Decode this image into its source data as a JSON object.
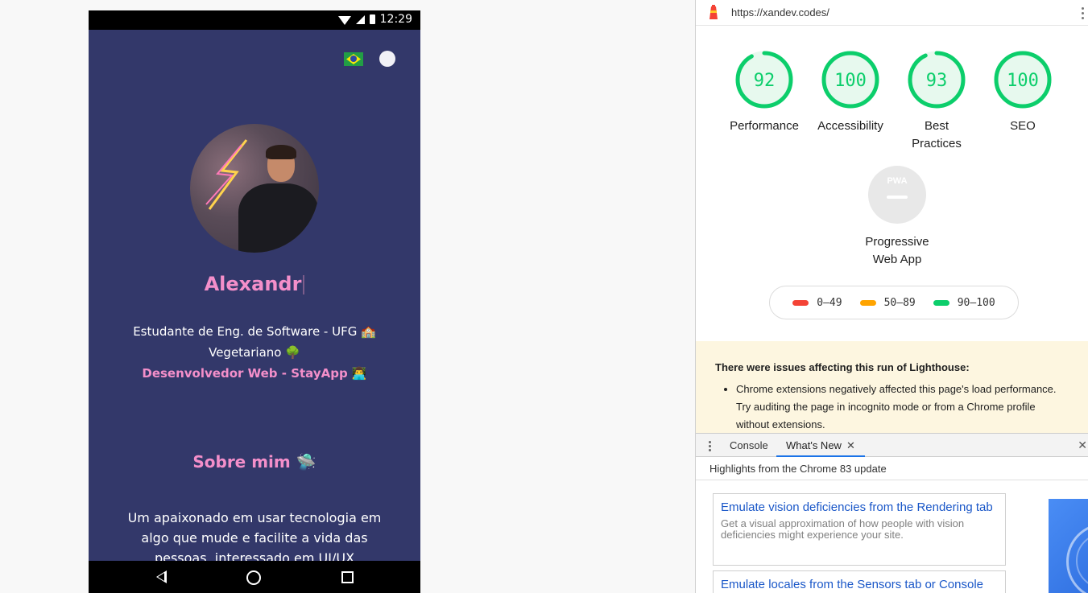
{
  "phone": {
    "status_time": "12:29",
    "name": "Alexandr",
    "bio_line1": "Estudante de Eng. de Software - UFG 🏫",
    "bio_line2": "Vegetariano 🌳",
    "bio_line3": "Desenvolvedor Web - StayApp 👨‍💻",
    "section_title": "Sobre mim 🛸",
    "about_text": "Um apaixonado em usar tecnologia em algo que mude e facilite a vida das pessoas, interessado em UI/UX"
  },
  "devtools": {
    "url": "https://xandev.codes/",
    "scores": [
      {
        "value": 92,
        "label": "Performance"
      },
      {
        "value": 100,
        "label": "Accessibility"
      },
      {
        "value": 93,
        "label": "Best Practices"
      },
      {
        "value": 100,
        "label": "SEO"
      }
    ],
    "pwa_badge": "PWA",
    "pwa_label": "Progressive Web App",
    "legend": [
      {
        "range": "0–49",
        "color": "#f44336"
      },
      {
        "range": "50–89",
        "color": "#ffa400"
      },
      {
        "range": "90–100",
        "color": "#0cce6b"
      }
    ],
    "warning_title": "There were issues affecting this run of Lighthouse:",
    "warning_item": "Chrome extensions negatively affected this page's load performance. Try auditing the page in incognito mode or from a Chrome profile without extensions.",
    "tab_console": "Console",
    "tab_whatsnew": "What's New",
    "tab_close_symbol": "✕",
    "drawer_close_symbol": "✕",
    "highlights": "Highlights from the Chrome 83 update",
    "card1_title": "Emulate vision deficiencies from the Rendering tab",
    "card1_desc": "Get a visual approximation of how people with vision deficiencies might experience your site.",
    "card2_title": "Emulate locales from the Sensors tab or Console"
  },
  "colors": {
    "phone_bg": "#33386a",
    "accent_pink": "#f48fca",
    "score_green": "#0cce6b",
    "link_blue": "#1a57c8"
  }
}
